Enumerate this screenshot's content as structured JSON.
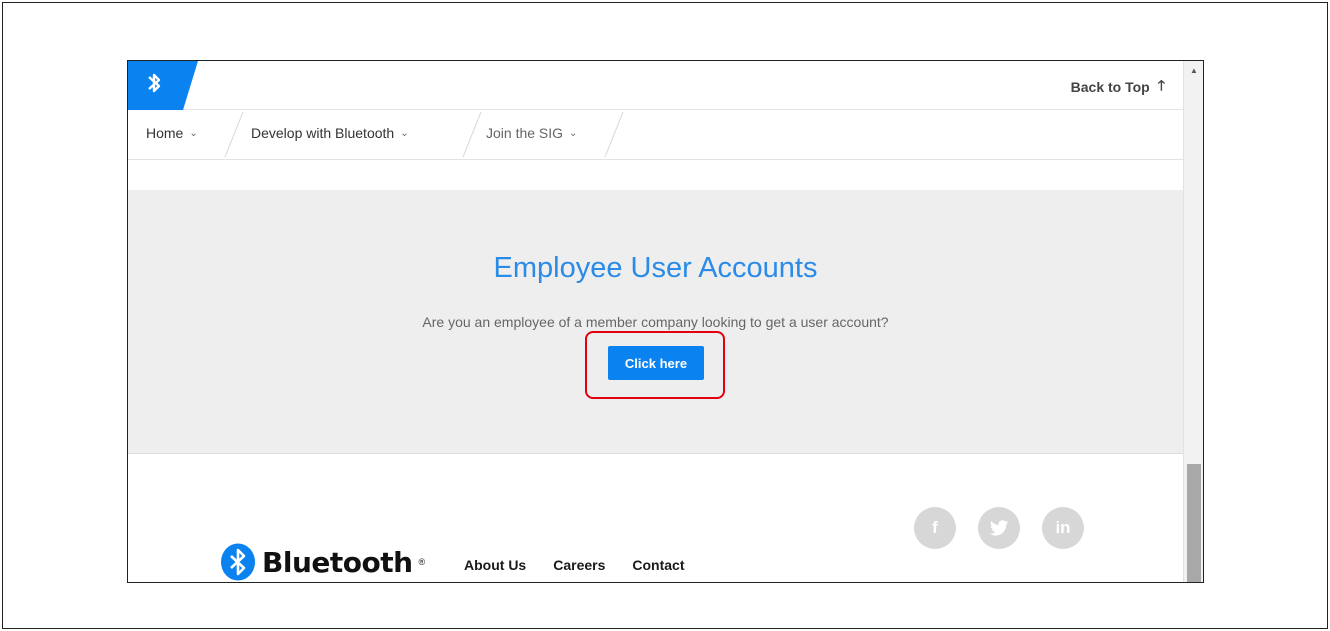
{
  "header": {
    "back_to_top": "Back to Top",
    "back_arrow": "🡑"
  },
  "nav": {
    "items": [
      {
        "label": "Home"
      },
      {
        "label": "Develop with Bluetooth"
      },
      {
        "label": "Join the SIG"
      }
    ]
  },
  "hero": {
    "title": "Employee User Accounts",
    "text": "Are you an employee of a member company looking to get a user account?",
    "cta_label": "Click here"
  },
  "footer": {
    "brand": "Bluetooth",
    "reg_mark": "®",
    "links": [
      {
        "label": "About Us"
      },
      {
        "label": "Careers"
      },
      {
        "label": "Contact"
      }
    ],
    "social": [
      {
        "label": "f",
        "icon": "facebook-icon"
      },
      {
        "label": "🐦",
        "icon": "twitter-icon"
      },
      {
        "label": "in",
        "icon": "linkedin-icon"
      }
    ]
  },
  "colors": {
    "brand_blue": "#0a82f0",
    "title_blue": "#2b8be6",
    "highlight_red": "#e3000f"
  }
}
